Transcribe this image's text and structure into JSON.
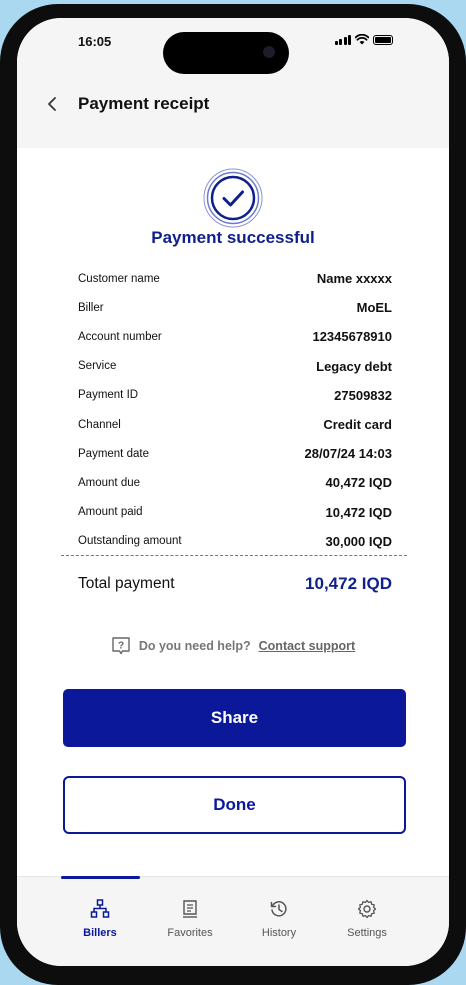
{
  "status_bar": {
    "time": "16:05"
  },
  "header": {
    "title": "Payment receipt"
  },
  "receipt": {
    "status": "Payment successful",
    "rows": [
      {
        "label": "Customer name",
        "value": "Name xxxxx"
      },
      {
        "label": "Biller",
        "value": "MoEL"
      },
      {
        "label": "Account number",
        "value": "12345678910"
      },
      {
        "label": "Service",
        "value": "Legacy debt"
      },
      {
        "label": "Payment ID",
        "value": "27509832"
      },
      {
        "label": "Channel",
        "value": "Credit card"
      },
      {
        "label": "Payment date",
        "value": "28/07/24 14:03"
      },
      {
        "label": "Amount due",
        "value": "40,472 IQD"
      },
      {
        "label": "Amount paid",
        "value": "10,472 IQD"
      },
      {
        "label": "Outstanding amount",
        "value": "30,000 IQD"
      }
    ],
    "total_label": "Total payment",
    "total_value": "10,472 IQD"
  },
  "help": {
    "question": "Do you need help?",
    "link": "Contact support"
  },
  "actions": {
    "share_label": "Share",
    "done_label": "Done"
  },
  "tabbar": {
    "items": [
      {
        "label": "Billers",
        "icon": "sitemap-icon",
        "active": true
      },
      {
        "label": "Favorites",
        "icon": "receipt-icon",
        "active": false
      },
      {
        "label": "History",
        "icon": "history-icon",
        "active": false
      },
      {
        "label": "Settings",
        "icon": "gear-icon",
        "active": false
      }
    ]
  },
  "colors": {
    "brand": "#0a1899",
    "brand_text": "#0f1f8c",
    "background": "#aad8f0"
  }
}
